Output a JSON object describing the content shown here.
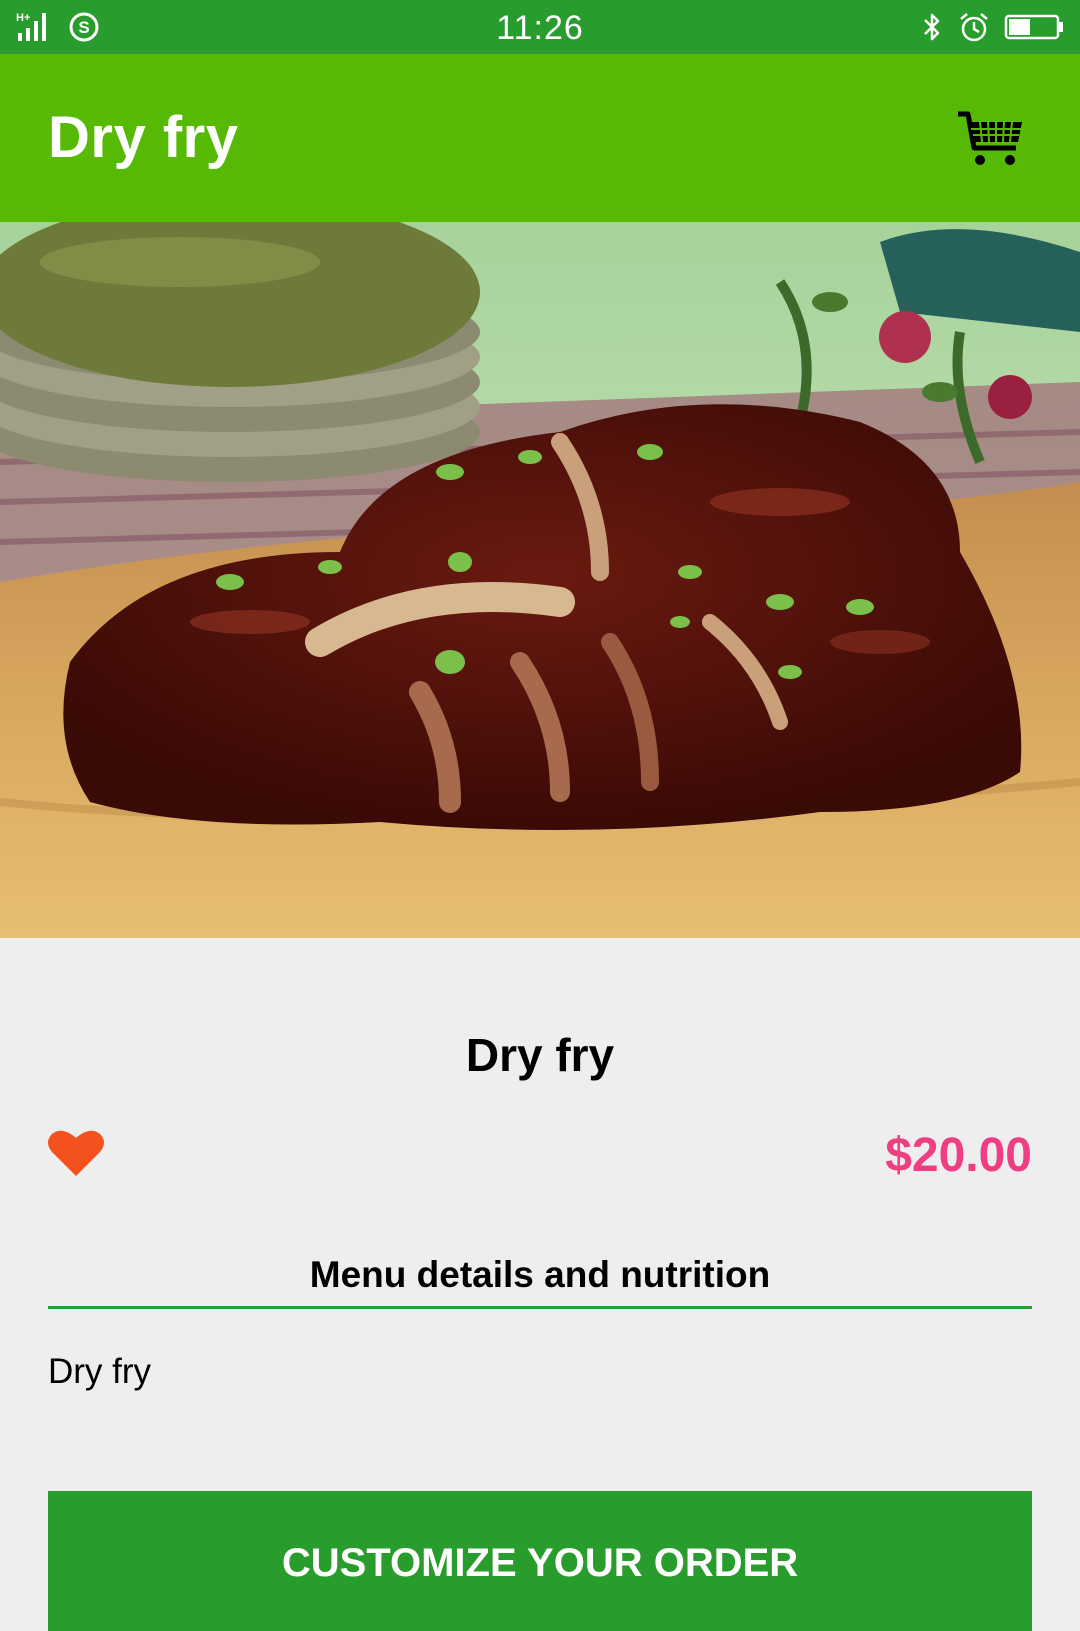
{
  "status_bar": {
    "time": "11:26",
    "network_label": "H+",
    "icons": [
      "signal-icon",
      "sync-icon",
      "bluetooth-icon",
      "alarm-icon",
      "battery-icon"
    ],
    "battery_level": 0.45,
    "background": "#289c2c"
  },
  "app_bar": {
    "title": "Dry fry",
    "cart_icon": "shopping-cart-icon",
    "background": "#56b904"
  },
  "product": {
    "name": "Dry fry",
    "price": "$20.00",
    "favorite_icon": "heart-icon",
    "price_color": "#ef3f82"
  },
  "details": {
    "section_title": "Menu details and nutrition",
    "description": "Dry fry"
  },
  "actions": {
    "customize_label": "CUSTOMIZE YOUR ORDER"
  },
  "colors": {
    "accent": "#289c2c",
    "page_background": "#eeeeee"
  }
}
